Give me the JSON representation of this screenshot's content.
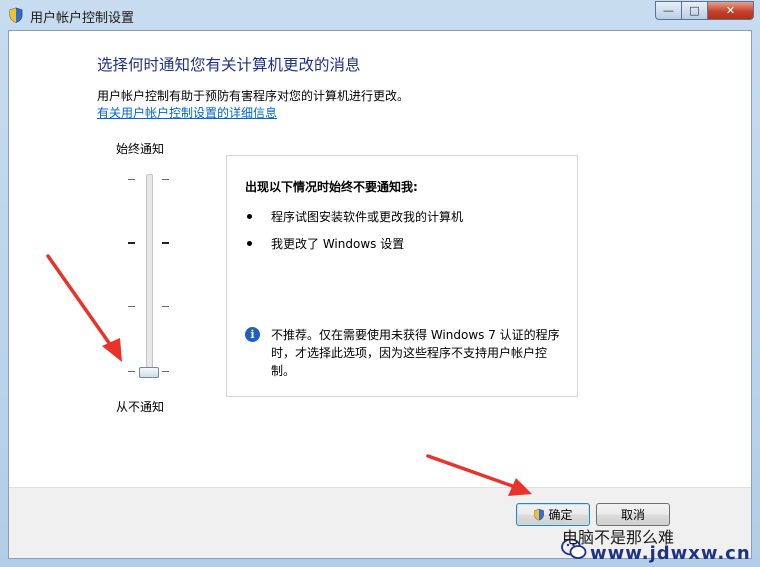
{
  "window": {
    "title": "用户帐户控制设置",
    "min_glyph": "—",
    "max_glyph": "□",
    "close_glyph": "✕"
  },
  "main": {
    "heading": "选择何时通知您有关计算机更改的消息",
    "description": "用户帐户控制有助于预防有害程序对您的计算机进行更改。",
    "link": "有关用户帐户控制设置的详细信息"
  },
  "slider": {
    "top_label": "始终通知",
    "bottom_label": "从不通知",
    "levels": 4,
    "selected_level": 1
  },
  "info": {
    "title": "出现以下情况时始终不要通知我:",
    "bullets": [
      "程序试图安装软件或更改我的计算机",
      "我更改了 Windows 设置"
    ],
    "note": "不推荐。仅在需要使用未获得 Windows 7 认证的程序时，才选择此选项，因为这些程序不支持用户帐户控制。"
  },
  "buttons": {
    "ok": "确定",
    "cancel": "取消"
  },
  "watermark": {
    "name": "电脑不是那么难",
    "url": "www.jdwxw.cn"
  },
  "colors": {
    "heading": "#1e3287",
    "link": "#0066cc",
    "annotation_arrow": "#e8322a"
  }
}
